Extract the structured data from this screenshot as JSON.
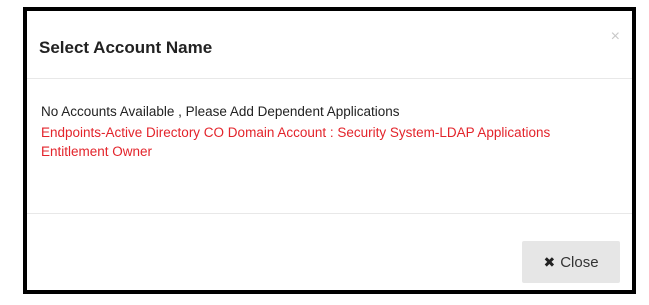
{
  "modal": {
    "title": "Select Account Name",
    "close_glyph": "×",
    "message": "No Accounts Available , Please Add Dependent Applications",
    "error_text": "Endpoints-Active Directory CO Domain Account : Security System-LDAP Applications Entitlement Owner",
    "close_button_icon": "✖",
    "close_button_label": "Close",
    "colors": {
      "error": "#e3242b",
      "border": "#000000",
      "button_bg": "#e6e6e6"
    },
    "icons": {
      "header_close": "close-icon",
      "button_close": "close-icon"
    }
  }
}
